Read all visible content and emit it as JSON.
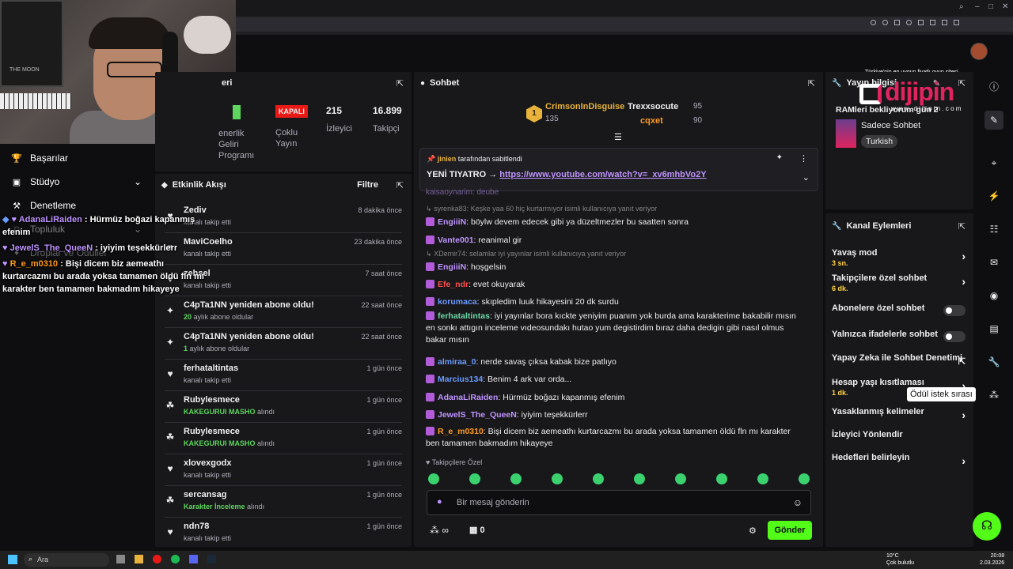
{
  "browser": {
    "min": "–",
    "max": "□",
    "close": "✕",
    "search": "⌕"
  },
  "watermark": {
    "top_text": "Türkiye'nin en uygun fiyatlı oyun sitesi",
    "brand": "dijipin",
    "url": "w w w . d i j i p i n . c o m"
  },
  "webcam": {
    "poster_text": "THE MOON"
  },
  "left_nav": [
    {
      "icon": "trophy-icon",
      "glyph": "🏆",
      "label": "Başarılar"
    },
    {
      "icon": "studio-icon",
      "glyph": "▣",
      "label": "Stüdyo"
    },
    {
      "icon": "moderation-icon",
      "glyph": "⚒",
      "label": "Denetleme"
    },
    {
      "icon": "community-icon",
      "glyph": "☺",
      "label": "Topluluk"
    },
    {
      "icon": "rewards-icon",
      "glyph": "♦",
      "label": "Droplar ve Ödüller"
    }
  ],
  "overlay_chat": [
    {
      "user": "AdanaLiRaiden",
      "color": "#bf94ff",
      "text": " : Hürmüz boğazi kapanmış efenim"
    },
    {
      "user": "JewelS_The_QueeN",
      "color": "#bf94ff",
      "text": " : iyiyim teşekkürlerr"
    },
    {
      "user": "R_e_m0310",
      "color": "#ff9a1f",
      "text": " : Bişi dicem biz aemeathı kurtarcazmı bu arada yoksa tamamen öldü fln mı karakter ben tamamen bakmadım hikayeye"
    }
  ],
  "stats": {
    "title_suffix": "eri",
    "status_badge": "KAPALI",
    "status_label": "Çoklu Yayın",
    "viewers_value": "215",
    "viewers_label": "İzleyici",
    "followers_value": "16.899",
    "followers_label": "Takipçi",
    "partial_1": "enerlik",
    "partial_2": "Geliri",
    "partial_3": "Programı"
  },
  "activity": {
    "title": "Etkinlik Akışı",
    "filter": "Filtre",
    "items": [
      {
        "icon": "heart-icon",
        "glyph": "♥",
        "name": "Zediv",
        "sub": "kanalı takip etti",
        "hl": "",
        "time": "8 dakika önce"
      },
      {
        "icon": "heart-icon",
        "glyph": "♥",
        "name": "MaviCoelho",
        "sub": "kanalı takip etti",
        "hl": "",
        "time": "23 dakika önce"
      },
      {
        "icon": "heart-icon",
        "glyph": "♥",
        "name": "zehsel",
        "sub": "kanalı takip etti",
        "hl": "",
        "time": "7 saat önce"
      },
      {
        "icon": "sparkle-icon",
        "glyph": "✦",
        "name": "C4pTa1NN yeniden abone oldu!",
        "sub": " aylık abone oldular",
        "hl": "20",
        "time": "22 saat önce"
      },
      {
        "icon": "sparkle-icon",
        "glyph": "✦",
        "name": "C4pTa1NN yeniden abone oldu!",
        "sub": " aylık abone oldular",
        "hl": "1",
        "time": "22 saat önce"
      },
      {
        "icon": "heart-icon",
        "glyph": "♥",
        "name": "ferhataltintas",
        "sub": "kanalı takip etti",
        "hl": "",
        "time": "1 gün önce"
      },
      {
        "icon": "channel-points-icon",
        "glyph": "☘",
        "name": "Rubylesmece",
        "sub": " alındı",
        "hl": "KAKEGURUI MASHO",
        "time": "1 gün önce"
      },
      {
        "icon": "channel-points-icon",
        "glyph": "☘",
        "name": "Rubylesmece",
        "sub": " alındı",
        "hl": "KAKEGURUI MASHO",
        "time": "1 gün önce"
      },
      {
        "icon": "heart-icon",
        "glyph": "♥",
        "name": "xlovexgodx",
        "sub": "kanalı takip etti",
        "hl": "",
        "time": "1 gün önce"
      },
      {
        "icon": "channel-points-icon",
        "glyph": "☘",
        "name": "sercansag",
        "sub": " alındı",
        "hl": "Karakter İnceleme",
        "time": "1 gün önce"
      },
      {
        "icon": "heart-icon",
        "glyph": "♥",
        "name": "ndn78",
        "sub": "kanalı takip etti",
        "hl": "",
        "time": "1 gün önce"
      }
    ]
  },
  "chat": {
    "title": "Sohbet",
    "leaderboard": {
      "rank": "1",
      "first_user": "CrimsonInDisguise",
      "first_points": "135",
      "second_user": "Trexxsocute",
      "second_points": "95",
      "third_user": "cqxet",
      "third_points": "90"
    },
    "pinned": {
      "by_user": "jinien",
      "by_text": " tarafından sabitlendi",
      "text": "YENİ TIYATRO → ",
      "link": "https://www.youtube.com/watch?v=_xv6mhbVo2Y"
    },
    "partial_top": "kaisaoynarim: deube",
    "messages": [
      {
        "type": "reply",
        "text": "syrenka83: Keşke yaa 60 hiç kurtarmıyor isimli kullanıcıya yanıt veriyor"
      },
      {
        "type": "msg",
        "user": "EngiiiN",
        "color": "#bf94ff",
        "text": ": böylw devem edecek gibi ya düzeltmezler bu saatten sonra"
      },
      {
        "type": "msg",
        "user": "Vante001",
        "color": "#bf94ff",
        "text": ": reanimal gir"
      },
      {
        "type": "reply",
        "text": "XDemir74: selamlar iyi yayınlar isimli kullanıcıya yanıt veriyor"
      },
      {
        "type": "msg",
        "user": "EngiiiN",
        "color": "#bf94ff",
        "text": ": hoşgelsin"
      },
      {
        "type": "msg",
        "user": "Efe_ndr",
        "color": "#ff4f4f",
        "text": ": evet okuyarak"
      },
      {
        "type": "msg",
        "user": "korumaca",
        "color": "#6b9cff",
        "text": ": skıpledim luuk hikayesini 20 dk surdu"
      },
      {
        "type": "msg",
        "user": "ferhataltintas",
        "color": "#6fd6a8",
        "text": ": iyi yayınlar bora kıckte yeniyim puanım yok burda ama karakterime bakabilir mısın en sonkı attıgın inceleme vıdeosundakı hutao yum degistirdim bıraz daha dedigin gibi nasıl olmus bakar mısın"
      },
      {
        "type": "msg",
        "user": "almiraa_0",
        "color": "#6b9cff",
        "text": ": nerde savaş çıksa kabak bize patlıyo"
      },
      {
        "type": "msg",
        "user": "Marcius134",
        "color": "#6b9cff",
        "text": ": Benim 4 ark var orda..."
      },
      {
        "type": "msg",
        "user": "AdanaLiRaiden",
        "color": "#bf94ff",
        "text": ": Hürmüz boğazı kapanmış efenim"
      },
      {
        "type": "msg",
        "user": "JewelS_The_QueeN",
        "color": "#bf94ff",
        "text": ": iyiyim teşekkürlerr"
      },
      {
        "type": "msg",
        "user": "R_e_m0310",
        "color": "#ff9a1f",
        "text": ": Bişi dicem biz aemeathı kurtarcazmı bu arada yoksa tamamen öldü fln mı karakter ben tamamen bakmadım hikayeye"
      }
    ],
    "followers_only_label": "Takipçilere Özel",
    "input_placeholder": "Bir mesaj gönderin",
    "points_value": "∞",
    "shop_value": "0",
    "send_label": "Gönder"
  },
  "stream_info": {
    "title": "Yayın bilgisi",
    "stream_title": "RAMleri bekliyorum gün 2",
    "category": "Sadece Sohbet",
    "tag": "Turkish"
  },
  "channel_actions": {
    "title": "Kanal Eylemleri",
    "items": [
      {
        "label": "Yavaş mod",
        "sub": "3 sn.",
        "ctl": "chevron"
      },
      {
        "label": "Takipçilere özel sohbet",
        "sub": "6 dk.",
        "ctl": "chevron"
      },
      {
        "label": "Abonelere özel sohbet",
        "sub": "",
        "ctl": "toggle"
      },
      {
        "label": "Yalnızca ifadelerle sohbet",
        "sub": "",
        "ctl": "toggle"
      },
      {
        "label": "Yapay Zeka ile Sohbet Denetimi",
        "sub": "",
        "ctl": "external"
      },
      {
        "label": "Hesap yaşı kısıtlaması",
        "sub": "1 dk.",
        "ctl": "chevron"
      },
      {
        "label": "Yasaklanmış kelimeler",
        "sub": "",
        "ctl": "chevron"
      },
      {
        "label": "İzleyici Yönlendir",
        "sub": "",
        "ctl": "none"
      },
      {
        "label": "Hedefleri belirleyin",
        "sub": "",
        "ctl": "chevron"
      }
    ]
  },
  "tooltip": "Ödül istek sırası",
  "taskbar": {
    "search_label": "Ara",
    "weather_temp": "10°C",
    "weather_text": "Çok bulutlu",
    "time": "20:08",
    "date": "2.03.2026"
  }
}
